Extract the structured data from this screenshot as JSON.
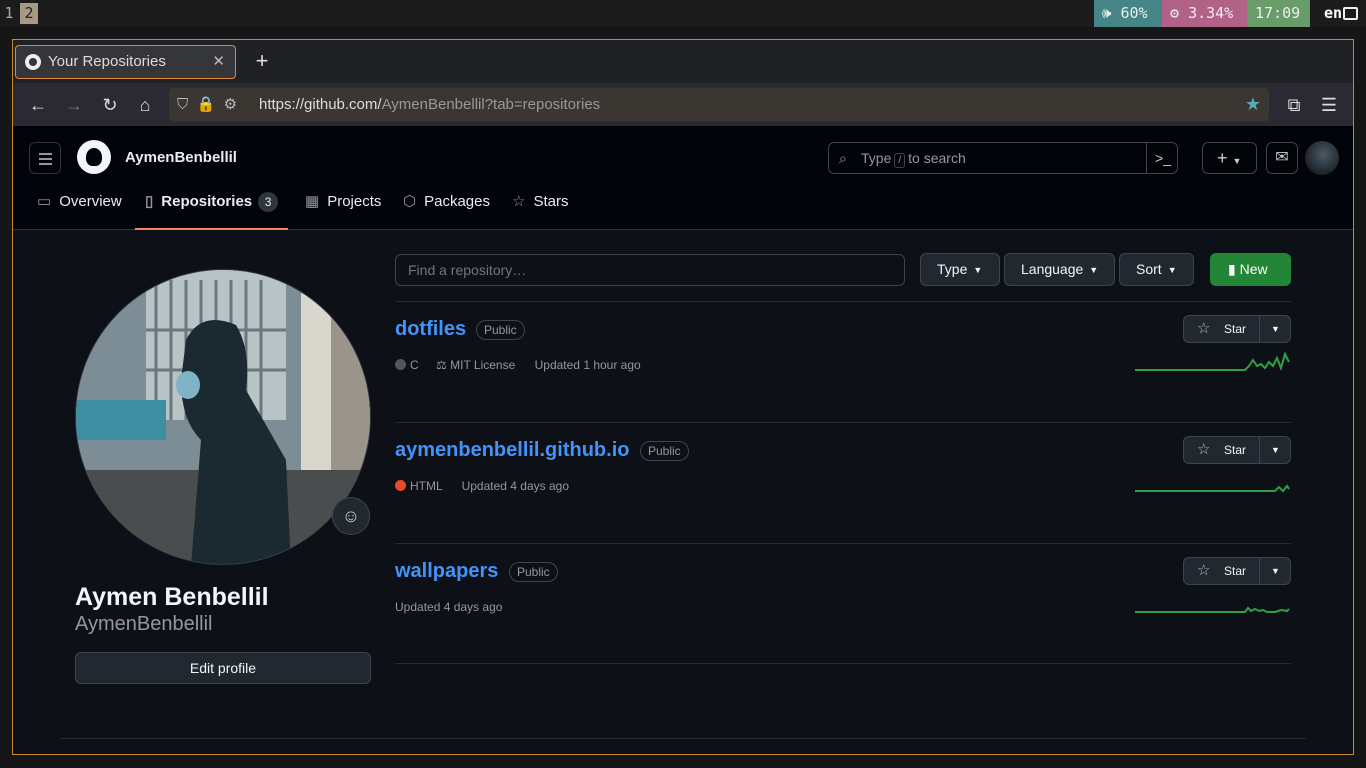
{
  "sysbar": {
    "workspaces": [
      "1",
      "2"
    ],
    "volume": "60%",
    "cpu": "3.34%",
    "time": "17:09",
    "lang": "en"
  },
  "browser": {
    "tab_title": "Your Repositories",
    "url_host": "https://github.com/",
    "url_path": "AymenBenbellil?tab=repositories"
  },
  "github": {
    "username": "AymenBenbellil",
    "search_prefix": "Type",
    "search_key": "/",
    "search_suffix": "to search",
    "tabs": [
      {
        "label": "Overview",
        "icon": "book-icon"
      },
      {
        "label": "Repositories",
        "icon": "repo-icon",
        "count": "3"
      },
      {
        "label": "Projects",
        "icon": "table-icon"
      },
      {
        "label": "Packages",
        "icon": "package-icon"
      },
      {
        "label": "Stars",
        "icon": "star-icon"
      }
    ]
  },
  "profile": {
    "full_name": "Aymen Benbellil",
    "login": "AymenBenbellil",
    "edit_label": "Edit profile"
  },
  "filters": {
    "find_placeholder": "Find a repository…",
    "type": "Type",
    "language": "Language",
    "sort": "Sort",
    "new": "New"
  },
  "repos": [
    {
      "name": "dotfiles",
      "visibility": "Public",
      "language": "C",
      "lang_color": "#555555",
      "license": "MIT License",
      "updated": "Updated 1 hour ago",
      "star_label": "Star"
    },
    {
      "name": "aymenbenbellil.github.io",
      "visibility": "Public",
      "language": "HTML",
      "lang_color": "#e34c26",
      "updated": "Updated 4 days ago",
      "star_label": "Star"
    },
    {
      "name": "wallpapers",
      "visibility": "Public",
      "updated": "Updated 4 days ago",
      "star_label": "Star"
    }
  ],
  "colors": {
    "accent": "#4493f8",
    "new_button": "#238636",
    "active_tab": "#f78166"
  }
}
